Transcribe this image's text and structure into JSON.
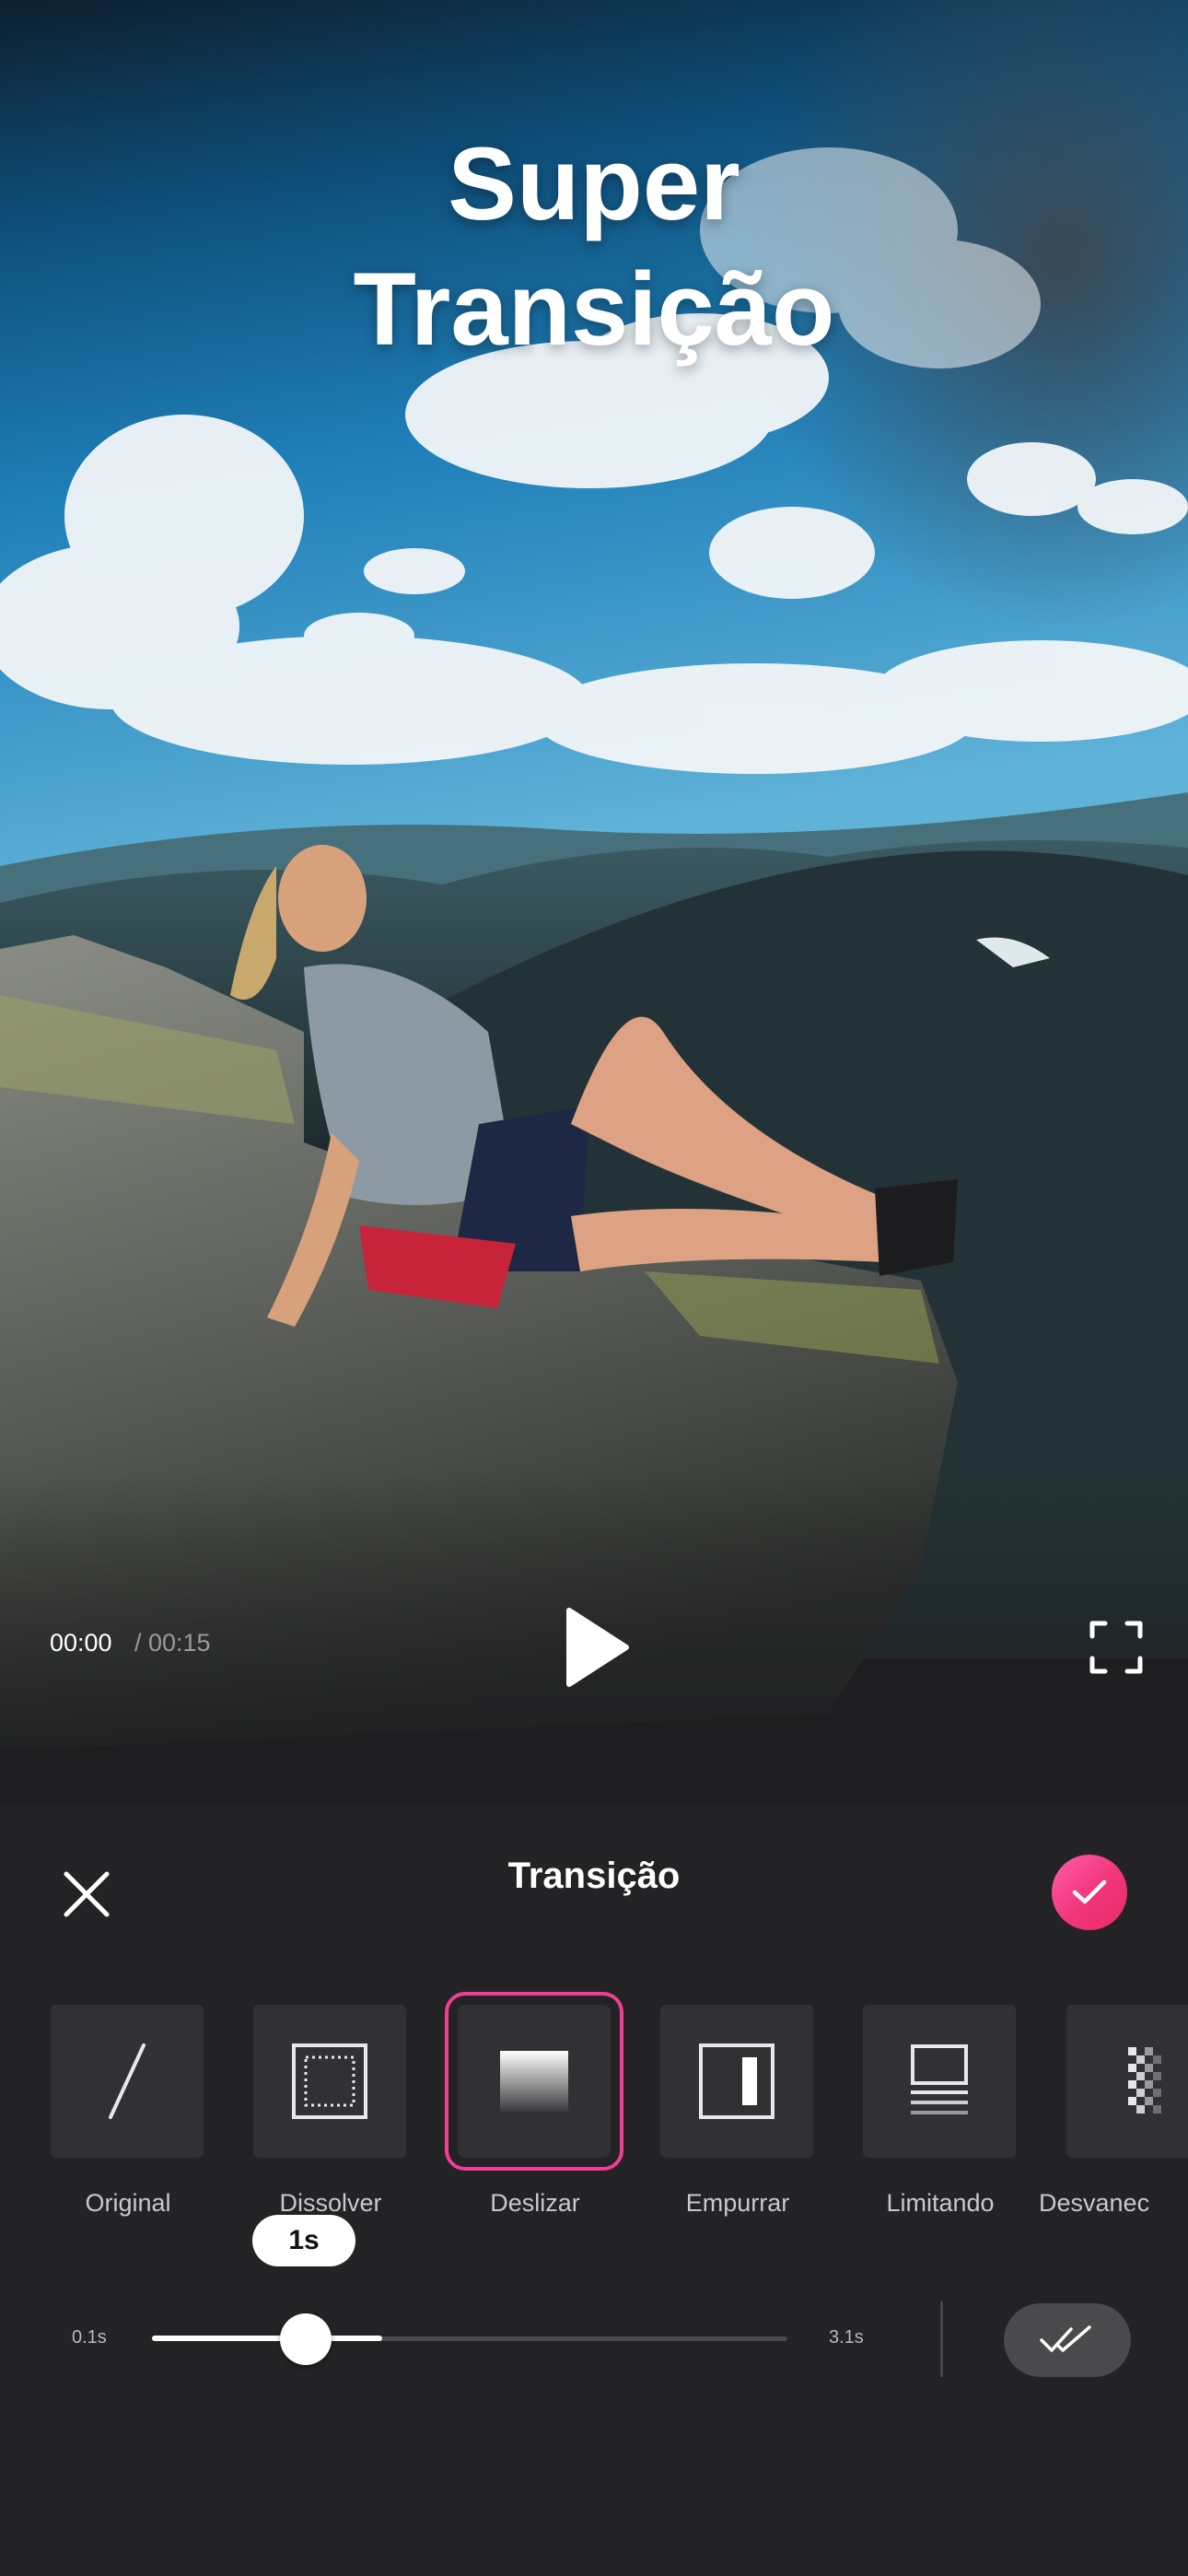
{
  "preview": {
    "overlay_title_line1": "Super",
    "overlay_title_line2": "Transição",
    "time_current": "00:00",
    "time_total": "/ 00:15",
    "play_icon": "play-icon",
    "fullscreen_icon": "fullscreen-icon"
  },
  "panel": {
    "title": "Transição",
    "close_icon": "close-icon",
    "confirm_icon": "check-icon",
    "accent_color": "#f23d92",
    "transitions": [
      {
        "label": "Original",
        "icon": "slash-icon",
        "selected": false
      },
      {
        "label": "Dissolver",
        "icon": "dissolve-icon",
        "selected": false
      },
      {
        "label": "Deslizar",
        "icon": "gradient-slide-icon",
        "selected": true
      },
      {
        "label": "Empurrar",
        "icon": "push-icon",
        "selected": false
      },
      {
        "label": "Limitando",
        "icon": "lines-icon",
        "selected": false
      },
      {
        "label": "Desvanec",
        "icon": "checker-fade-icon",
        "selected": false
      }
    ],
    "duration": {
      "min_label": "0.1s",
      "max_label": "3.1s",
      "value_label": "1s",
      "value": 1
    },
    "apply_all_icon": "double-check-icon"
  }
}
